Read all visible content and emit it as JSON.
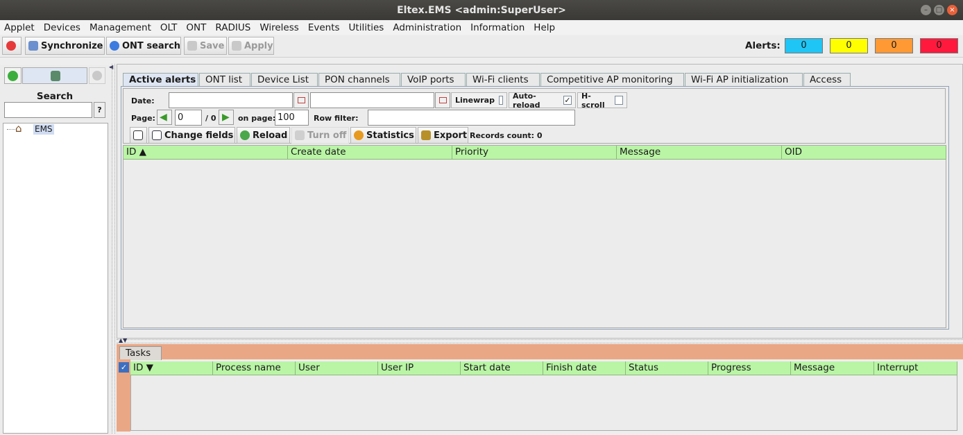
{
  "window": {
    "title": "Eltex.EMS <admin:SuperUser>"
  },
  "menu": [
    "Applet",
    "Devices",
    "Management",
    "OLT",
    "ONT",
    "RADIUS",
    "Wireless",
    "Events",
    "Utilities",
    "Administration",
    "Information",
    "Help"
  ],
  "toolbar": {
    "synchronize": "Synchronize",
    "ont_search": "ONT search",
    "save": "Save",
    "apply": "Apply",
    "alerts_label": "Alerts:",
    "alerts": [
      {
        "value": "0",
        "color": "#1ec5f5"
      },
      {
        "value": "0",
        "color": "#ffff00"
      },
      {
        "value": "0",
        "color": "#ff9933"
      },
      {
        "value": "0",
        "color": "#ff1a3d"
      }
    ]
  },
  "left": {
    "search_label": "Search",
    "help_button": "?",
    "tree_root": "EMS"
  },
  "tabs": [
    "Active alerts",
    "ONT list",
    "Device List",
    "PON channels",
    "VoIP ports",
    "Wi-Fi clients",
    "Competitive AP monitoring",
    "Wi-Fi AP initialization",
    "Access"
  ],
  "filter": {
    "date_label": "Date:",
    "linewrap": "Linewrap",
    "auto_reload": "Auto-reload",
    "auto_reload_check": "✓",
    "hscroll": "H-scroll",
    "page_label": "Page:",
    "page_value": "0",
    "page_total": "/ 0",
    "on_page_label": "on page:",
    "on_page_value": "100",
    "row_filter_label": "Row filter:",
    "change_fields": "Change fields",
    "reload": "Reload",
    "turn_off": "Turn off",
    "statistics": "Statistics",
    "export": "Export",
    "records_count": "Records count: 0"
  },
  "alerts_table": {
    "columns": [
      "ID ▲",
      "Create date",
      "Priority",
      "Message",
      "OID"
    ]
  },
  "tasks": {
    "tab": "Tasks",
    "columns": [
      "ID ▼",
      "Process name",
      "User",
      "User IP",
      "Start date",
      "Finish date",
      "Status",
      "Progress",
      "Message",
      "Interrupt"
    ]
  }
}
